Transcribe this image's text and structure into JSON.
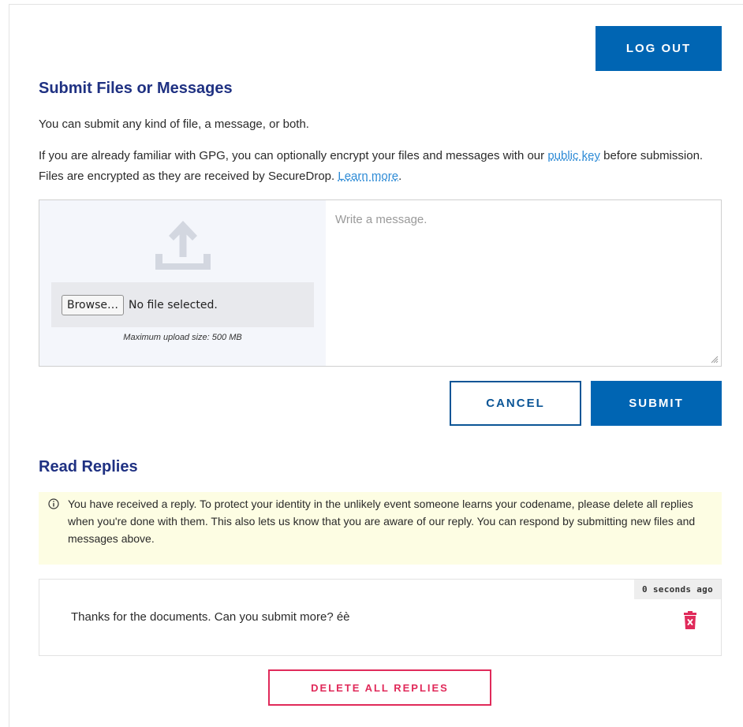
{
  "header": {
    "logout_label": "LOG OUT"
  },
  "submit_section": {
    "title": "Submit Files or Messages",
    "intro": "You can submit any kind of file, a message, or both.",
    "gpg_text_1": "If you are already familiar with GPG, you can optionally encrypt your files and messages with our ",
    "public_key_link": "public key",
    "gpg_text_2": " before submission. Files are encrypted as they are received by SecureDrop. ",
    "learn_more_link": "Learn more",
    "gpg_text_3": ".",
    "upload": {
      "icon": "upload-icon",
      "browse_label": "Browse…",
      "file_status": "No file selected.",
      "max_size": "Maximum upload size: 500 MB"
    },
    "message_placeholder": "Write a message.",
    "cancel_label": "CANCEL",
    "submit_label": "SUBMIT"
  },
  "replies_section": {
    "title": "Read Replies",
    "notice_icon": "info-icon",
    "notice": "You have received a reply. To protect your identity in the unlikely event someone learns your codename, please delete all replies when you're done with them. This also lets us know that you are aware of our reply. You can respond by submitting new files and messages above.",
    "replies": [
      {
        "timestamp": "0 seconds ago",
        "text": "Thanks for the documents. Can you submit more? éè",
        "delete_icon": "trash-icon"
      }
    ],
    "delete_all_label": "DELETE ALL REPLIES"
  },
  "colors": {
    "primary": "#0065b3",
    "heading": "#1f3182",
    "link": "#2e8bd6",
    "danger": "#e02a5a",
    "notice_bg": "#fdfde3"
  }
}
